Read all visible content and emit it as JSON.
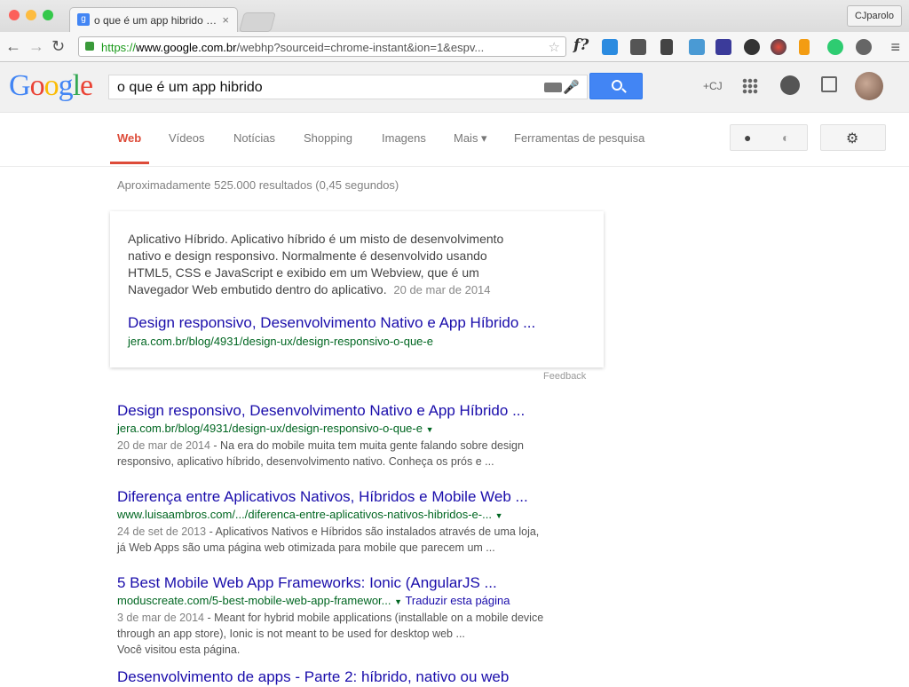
{
  "browser": {
    "tab_title": "o que é um app hibrido - G",
    "tab_favicon": "g",
    "tab_close": "×",
    "user_button": "CJparolo",
    "url_scheme": "https://",
    "url_host": "www.google.com.br",
    "url_path": "/webhp?sourceid=chrome-instant&ion=1&espv...",
    "extension_f": "f?"
  },
  "google": {
    "logo_letters": [
      {
        "ch": "G",
        "color": "#4285f4"
      },
      {
        "ch": "o",
        "color": "#ea4335"
      },
      {
        "ch": "o",
        "color": "#fbbc05"
      },
      {
        "ch": "g",
        "color": "#4285f4"
      },
      {
        "ch": "l",
        "color": "#34a853"
      },
      {
        "ch": "e",
        "color": "#ea4335"
      }
    ],
    "query": "o que é um app hibrido",
    "plus_link": "+CJ"
  },
  "nav": {
    "tabs": [
      "Web",
      "Vídeos",
      "Notícias",
      "Shopping",
      "Imagens",
      "Mais ▾",
      "Ferramentas de pesquisa"
    ],
    "active": "Web"
  },
  "stats": "Aproximadamente 525.000 resultados (0,45 segundos)",
  "answer_box": {
    "snippet_lines": [
      "Aplicativo Híbrido. Aplicativo híbrido é um misto de desenvolvimento",
      "nativo e design responsivo. Normalmente é desenvolvido usando",
      "HTML5, CSS e JavaScript e exibido em um Webview, que é um",
      "Navegador Web embutido dentro do aplicativo."
    ],
    "date": "20 de mar de 2014",
    "link_title": "Design responsivo, Desenvolvimento Nativo e App Híbrido ...",
    "link_url": "jera.com.br/blog/4931/design-ux/design-responsivo-o-que-e",
    "feedback": "Feedback"
  },
  "results": [
    {
      "title": "Design responsivo, Desenvolvimento Nativo e App Híbrido ...",
      "url": "jera.com.br/blog/4931/design-ux/design-responsivo-o-que-e",
      "date": "20 de mar de 2014",
      "desc1": " - Na era do mobile muita tem muita gente falando sobre design",
      "desc2": "responsivo, aplicativo híbrido, desenvolvimento nativo. Conheça os prós e ...",
      "translate": "",
      "visited": ""
    },
    {
      "title": "Diferença entre Aplicativos Nativos, Híbridos e Mobile Web ...",
      "url": "www.luisaambros.com/.../diferenca-entre-aplicativos-nativos-hibridos-e-...",
      "date": "24 de set de 2013",
      "desc1": " - Aplicativos Nativos e Híbridos são instalados através de uma loja,",
      "desc2": "já Web Apps são uma página web otimizada para mobile que parecem um ...",
      "translate": "",
      "visited": ""
    },
    {
      "title": "5 Best Mobile Web App Frameworks: Ionic (AngularJS ...",
      "url": "moduscreate.com/5-best-mobile-web-app-framewor...",
      "date": "3 de mar de 2014",
      "desc1": " - Meant for hybrid mobile applications (installable on a mobile device",
      "desc2": "through an app store), Ionic is not meant to be used for desktop web ...",
      "translate": "Traduzir esta página",
      "visited": "Você visitou esta página."
    },
    {
      "title": "Desenvolvimento de apps - Parte 2: híbrido, nativo ou web",
      "url": "",
      "date": "",
      "desc1": "",
      "desc2": "",
      "translate": "",
      "visited": ""
    }
  ],
  "colors": {
    "accent_red": "#dd4b39",
    "link_blue": "#1a0dab",
    "url_green": "#006621",
    "search_blue": "#4285f4"
  },
  "icons": [
    "back-arrow-icon",
    "forward-arrow-icon",
    "reload-icon",
    "lock-icon",
    "star-icon",
    "search-icon",
    "microphone-icon",
    "keyboard-icon",
    "apps-grid-icon",
    "notifications-icon",
    "share-icon",
    "user-icon",
    "globe-icon",
    "gear-icon",
    "menu-icon"
  ]
}
